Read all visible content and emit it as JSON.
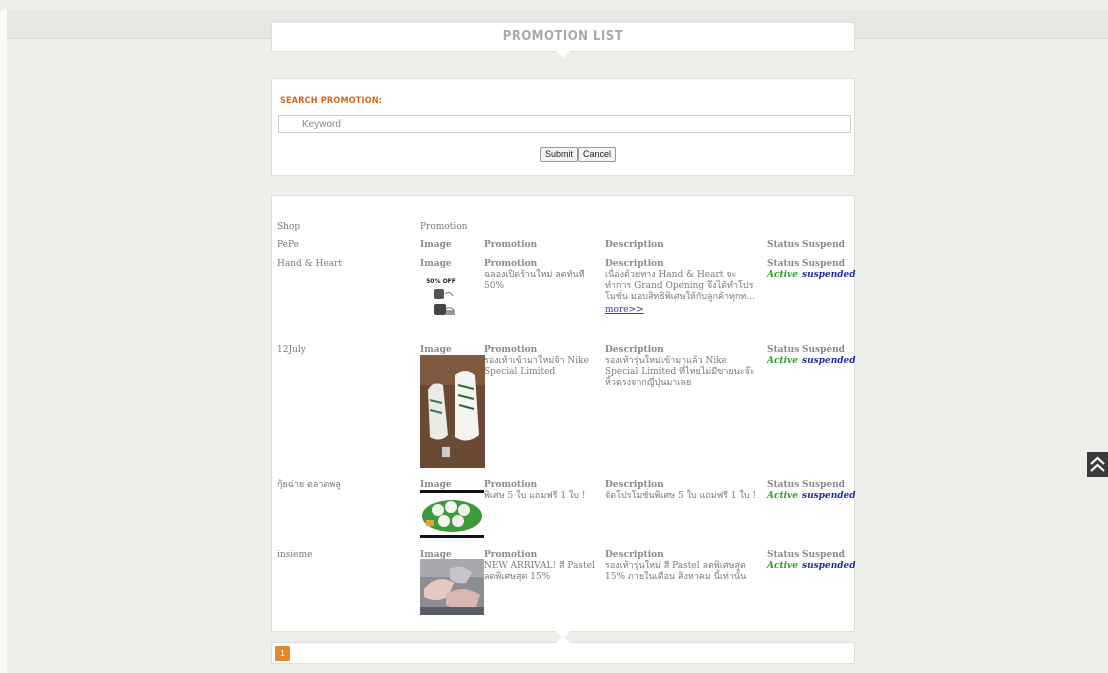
{
  "page_title": "PROMOTION LIST",
  "search": {
    "label": "SEARCH PROMOTION:",
    "placeholder": "Keyword",
    "submit_label": "Submit",
    "cancel_label": "Cancel"
  },
  "table": {
    "col_shop": "Shop",
    "col_promotion": "Promotion",
    "sub_headers": {
      "image": "Image",
      "promotion": "Promotion",
      "description": "Description",
      "status": "Status",
      "suspend": "Suspend"
    },
    "first_shop": "PePe",
    "rows": [
      {
        "shop": "Hand & Heart",
        "image_label": "Image",
        "promotion_label": "Promotion",
        "promotion": "ฉลองเปิดร้านใหม่ ลดทันที 50%",
        "description_label": "Description",
        "description": "เนื่องด้วยทาง Hand & Heart จะทำการ Grand Opening จึงได้ทำโปรโมชั่น มอบสิทธิพิเศษให้กับลูกค้าทุกท...",
        "more": "more>>",
        "status_label": "Status",
        "status": "Active",
        "suspend_label": "Suspend",
        "suspend": "suspended",
        "image_text": "50% OFF"
      },
      {
        "shop": "12July",
        "image_label": "Image",
        "promotion_label": "Promotion",
        "promotion": "รองเท้าเข้ามาใหม่จ้า Nike Special Limited",
        "description_label": "Description",
        "description": "รองเท้ารุ่นใหม่เข้ามาแล้ว Nike Special Limited ที่ไทยไม่มีขายนะจ๊ะ หิ้วตรงจากญี่ปุ่นมาเลย",
        "status_label": "Status",
        "status": "Active",
        "suspend_label": "Suspend",
        "suspend": "suspended"
      },
      {
        "shop": "กุ้ยฉ่าย ตลาดพลู",
        "image_label": "Image",
        "promotion_label": "Promotion",
        "promotion": "พิเศษ 5 ใบ แถมฟรี 1 ใบ !",
        "description_label": "Description",
        "description": "จัดโปรโมชั่นพิเศษ 5 ใบ แถมฟรี 1 ใบ !",
        "status_label": "Status",
        "status": "Active",
        "suspend_label": "Suspend",
        "suspend": "suspended"
      },
      {
        "shop": "insieme",
        "image_label": "Image",
        "promotion_label": "Promotion",
        "promotion": "NEW ARRIVAL! สี Pastel ลดพิเศษสุด 15%",
        "description_label": "Description",
        "description": "รองเท้ารุ่นใหม่ สี Pastel ลดพิเศษสุด 15% ภายในเดือน สิงหาคม นี้เท่านั้น",
        "status_label": "Status",
        "status": "Active",
        "suspend_label": "Suspend",
        "suspend": "suspended"
      }
    ]
  },
  "pagination": {
    "current_page": "1"
  },
  "icons": {
    "scroll_top": "double-chevron-up-icon",
    "search": "search-icon"
  },
  "colors": {
    "accent_orange": "#d2691e",
    "page_button": "#e08a2b",
    "status_active": "#2ca02c",
    "suspend_link": "#1e2d9e"
  }
}
